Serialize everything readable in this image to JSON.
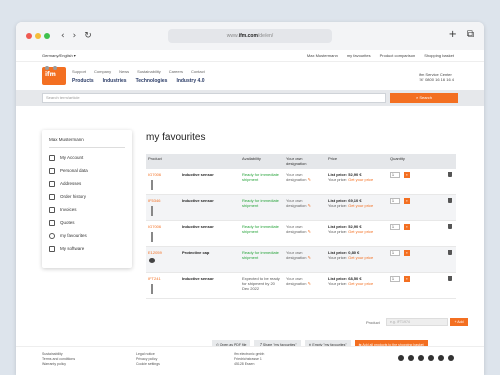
{
  "browser": {
    "url_prefix": "www.",
    "url_domain": "ifm.com",
    "url_path": "/de/en/",
    "plus_label": "+",
    "tabs_label": "⧉",
    "back_label": "‹",
    "forward_label": "›",
    "reload_label": "↻"
  },
  "topbar": {
    "locale": "Germany/English ▾",
    "user": "Max Mustermann",
    "favourites": "my favourites",
    "comparison": "Product comparison",
    "cart": "Shopping basket"
  },
  "nav": {
    "logo": "ifm",
    "small": [
      "Support",
      "Company",
      "News",
      "Sustainability",
      "Careers",
      "Contact"
    ],
    "big": [
      "Products",
      "Industries",
      "Technologies",
      "Industry 4.0"
    ],
    "service_title": "ifm Service Center",
    "service_phone": "☏ 0800 16 16 16 4"
  },
  "search": {
    "placeholder": "Search term/article",
    "button": "⌕ Search"
  },
  "sidebar": {
    "user": "Max Mustermann",
    "items": [
      "My Account",
      "Personal data",
      "Addresses",
      "Order history",
      "Invoices",
      "Quotes",
      "my favourites",
      "My software"
    ]
  },
  "page_title": "my favourites",
  "table": {
    "headers": [
      "Product",
      "Availability",
      "Your own designation",
      "Price",
      "Quantity"
    ],
    "rows": [
      {
        "no": "IG7006",
        "name": "Inductive sensor",
        "avail": "Ready for immediate shipment",
        "des": "Your own designation",
        "list": "List price: 52,90 €",
        "your": "Your price: ",
        "your_link": "Get your price",
        "qty": "1"
      },
      {
        "no": "IF5346",
        "name": "Inductive sensor",
        "avail": "Ready for immediate shipment",
        "des": "Your own designation",
        "list": "List price: 69,10 €",
        "your": "Your price: ",
        "your_link": "Get your price",
        "qty": "1"
      },
      {
        "no": "IG7006",
        "name": "Inductive sensor",
        "avail": "Ready for immediate shipment",
        "des": "Your own designation",
        "list": "List price: 52,90 €",
        "your": "Your price: ",
        "your_link": "Get your price",
        "qty": "1"
      },
      {
        "no": "E12059",
        "name": "Protective cap",
        "avail": "Ready for immediate shipment",
        "des": "Your own designation",
        "list": "List price: 0,80 €",
        "your": "Your price: ",
        "your_link": "Get your price",
        "qty": "1"
      },
      {
        "no": "IFT241",
        "name": "Inductive sensor",
        "avail": "Expected to be ready for shipment by 20 Dec 2022",
        "des": "Your own designation",
        "list": "List price: 68,50 €",
        "your": "Your price: ",
        "your_link": "Get your price",
        "qty": "1"
      }
    ]
  },
  "add": {
    "label": "Product",
    "placeholder": "e.g. IFT1974",
    "button": "+ Add"
  },
  "actions": [
    "⎙ Open as PDF file",
    "⤴ Share \"my favourites\"",
    "✕ Empty \"my favourites\"",
    "⇆ Add all products to the shopping basket"
  ],
  "footer": {
    "col1": [
      "Sustainability",
      "Terms and conditions",
      "Warranty policy"
    ],
    "col2": [
      "Legal notice",
      "Privacy policy",
      "Cookie settings"
    ],
    "col3": [
      "ifm electronic gmbh",
      "Friedrichstrasse 1",
      "45128 Essen"
    ]
  },
  "colors": {
    "accent": "#f36f21",
    "nav": "#2a3b66",
    "available": "#27a33a"
  }
}
